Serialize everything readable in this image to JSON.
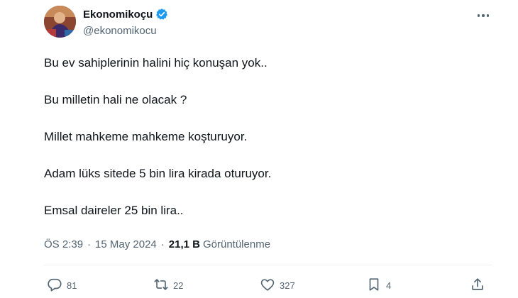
{
  "tweet": {
    "author": {
      "name": "Ekonomikoçu",
      "handle": "@ekonomikocu"
    },
    "paragraphs": [
      "Bu ev sahiplerinin halini hiç konuşan yok..",
      "Bu milletin hali ne olacak ?",
      "Millet mahkeme mahkeme koşturuyor.",
      "Adam lüks sitede 5 bin lira kirada oturuyor.",
      "Emsal daireler 25 bin lira.."
    ],
    "meta": {
      "time": "ÖS 2:39",
      "separator": "·",
      "date": "15 May 2024",
      "views_count": "21,1 B",
      "views_label": "Görüntülenme"
    },
    "actions": {
      "replies": "81",
      "retweets": "22",
      "likes": "327",
      "bookmarks": "4"
    },
    "icons": {
      "verified": "verified-badge-icon",
      "more": "more-icon",
      "reply": "reply-icon",
      "retweet": "retweet-icon",
      "like": "heart-icon",
      "bookmark": "bookmark-icon",
      "share": "share-icon"
    },
    "colors": {
      "verified_blue": "#1d9bf0",
      "secondary_text": "#536471",
      "primary_text": "#0f1419"
    }
  }
}
